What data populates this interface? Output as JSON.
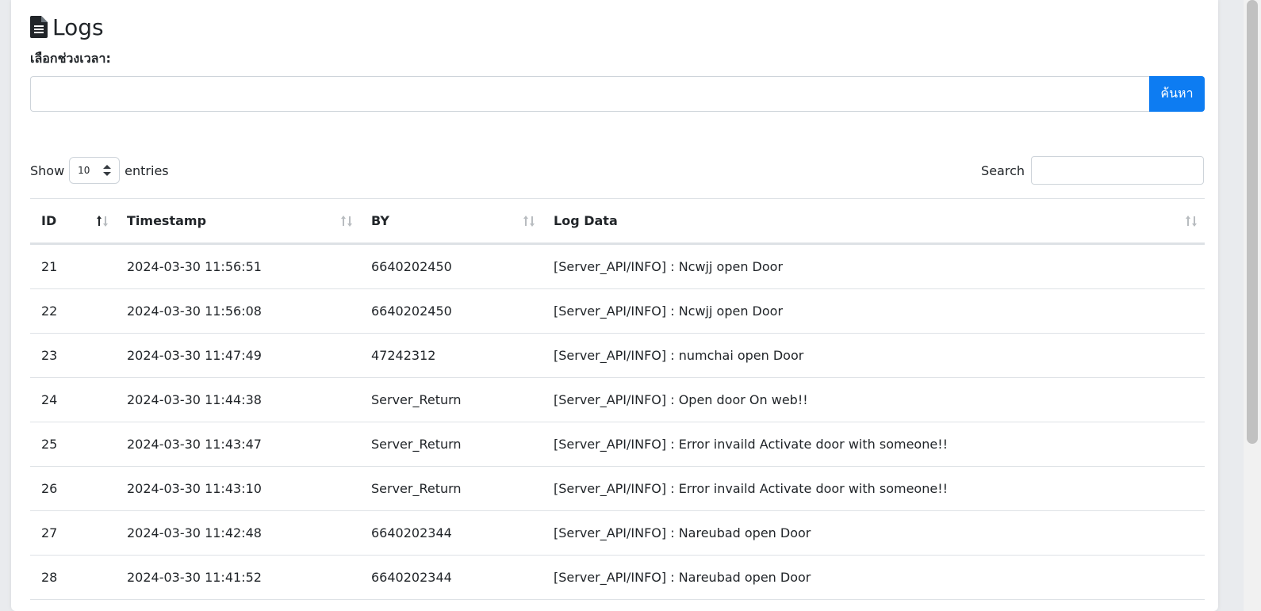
{
  "page": {
    "title": "Logs",
    "title_icon": "file-text-icon"
  },
  "filter": {
    "range_label": "เลือกช่วงเวลา:",
    "range_value": "",
    "search_button": "ค้นหา"
  },
  "table_controls": {
    "show_label": "Show",
    "page_length": "10",
    "entries_label": "entries",
    "search_label": "Search",
    "search_value": ""
  },
  "table": {
    "columns": [
      "ID",
      "Timestamp",
      "BY",
      "Log Data"
    ],
    "sorted_column": "ID",
    "rows": [
      {
        "id": "21",
        "timestamp": "2024-03-30 11:56:51",
        "by": "6640202450",
        "log": "[Server_API/INFO] : Ncwjj open Door"
      },
      {
        "id": "22",
        "timestamp": "2024-03-30 11:56:08",
        "by": "6640202450",
        "log": "[Server_API/INFO] : Ncwjj open Door"
      },
      {
        "id": "23",
        "timestamp": "2024-03-30 11:47:49",
        "by": "47242312",
        "log": "[Server_API/INFO] : numchai open Door"
      },
      {
        "id": "24",
        "timestamp": "2024-03-30 11:44:38",
        "by": "Server_Return",
        "log": "[Server_API/INFO] : Open door On web!!"
      },
      {
        "id": "25",
        "timestamp": "2024-03-30 11:43:47",
        "by": "Server_Return",
        "log": "[Server_API/INFO] : Error invaild Activate door with someone!!"
      },
      {
        "id": "26",
        "timestamp": "2024-03-30 11:43:10",
        "by": "Server_Return",
        "log": "[Server_API/INFO] : Error invaild Activate door with someone!!"
      },
      {
        "id": "27",
        "timestamp": "2024-03-30 11:42:48",
        "by": "6640202344",
        "log": "[Server_API/INFO] : Nareubad open Door"
      },
      {
        "id": "28",
        "timestamp": "2024-03-30 11:41:52",
        "by": "6640202344",
        "log": "[Server_API/INFO] : Nareubad open Door"
      }
    ]
  },
  "colors": {
    "primary": "#0d7cf2",
    "border": "#dee2e6",
    "text": "#212529"
  }
}
